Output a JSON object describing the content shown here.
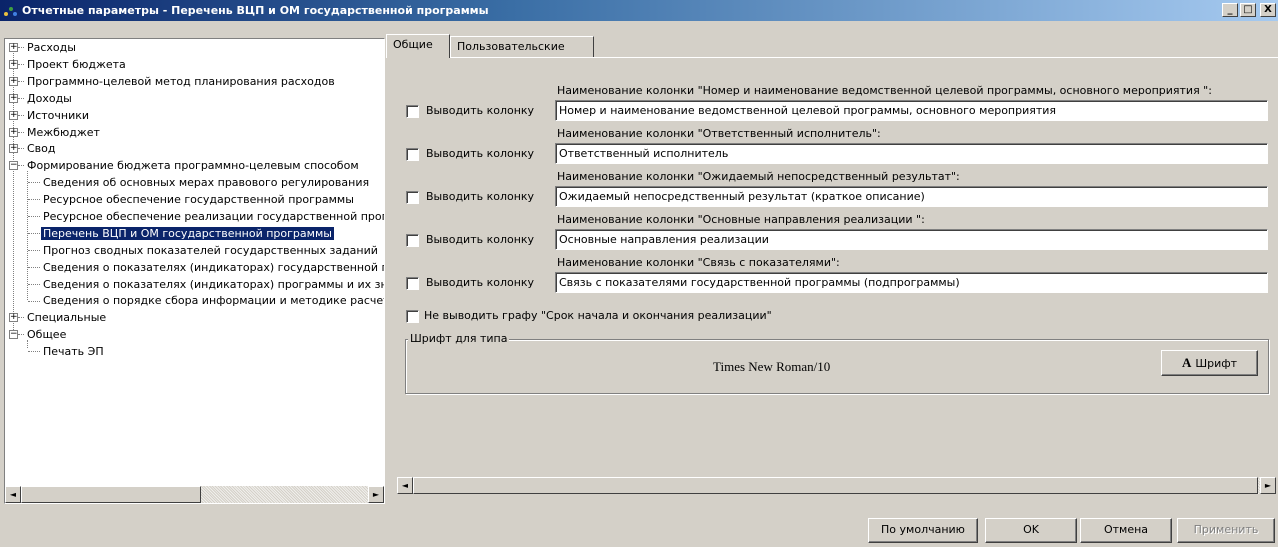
{
  "window": {
    "title": "Отчетные параметры - Перечень ВЦП и ОМ государственной программы",
    "minimize_glyph": "_",
    "maximize_glyph": "□",
    "close_glyph": "X"
  },
  "tree": {
    "items": [
      {
        "label": "Расходы",
        "expander": "+"
      },
      {
        "label": "Проект бюджета",
        "expander": "+"
      },
      {
        "label": "Программно-целевой метод планирования расходов",
        "expander": "+"
      },
      {
        "label": "Доходы",
        "expander": "+"
      },
      {
        "label": "Источники",
        "expander": "+"
      },
      {
        "label": "Межбюджет",
        "expander": "+"
      },
      {
        "label": "Свод",
        "expander": "+"
      },
      {
        "label": "Формирование бюджета программно-целевым способом",
        "expander": "−"
      },
      {
        "label": "Сведения об основных мерах правового регулирования"
      },
      {
        "label": "Ресурсное обеспечение государственной программы"
      },
      {
        "label": "Ресурсное обеспечение реализации государственной программы"
      },
      {
        "label": "Перечень ВЦП и ОМ государственной программы",
        "selected": true
      },
      {
        "label": "Прогноз сводных показателей государственных заданий"
      },
      {
        "label": "Сведения о показателях (индикаторах) государственной программы"
      },
      {
        "label": "Сведения о показателях (индикаторах) программы и их значениях"
      },
      {
        "label": "Сведения о порядке сбора информации и методике расчета"
      },
      {
        "label": "Специальные",
        "expander": "+"
      },
      {
        "label": "Общее",
        "expander": "−"
      },
      {
        "label": "Печать ЭП"
      }
    ]
  },
  "tabs": [
    {
      "label": "Общие",
      "active": true
    },
    {
      "label": "Пользовательские",
      "active": false
    }
  ],
  "columns": [
    {
      "caption": "Наименование колонки \"Номер и наименование ведомственной целевой программы, основного мероприятия \":",
      "checkbox_label": "Выводить колонку",
      "checked": false,
      "value": "Номер и наименование ведомственной целевой программы, основного мероприятия"
    },
    {
      "caption": "Наименование колонки \"Ответственный исполнитель\":",
      "checkbox_label": "Выводить колонку",
      "checked": false,
      "value": "Ответственный исполнитель"
    },
    {
      "caption": "Наименование колонки \"Ожидаемый непосредственный результат\":",
      "checkbox_label": "Выводить колонку",
      "checked": false,
      "value": "Ожидаемый непосредственный результат (краткое описание)"
    },
    {
      "caption": "Наименование колонки \"Основные направления реализации \":",
      "checkbox_label": "Выводить колонку",
      "checked": false,
      "value": "Основные направления реализации"
    },
    {
      "caption": "Наименование колонки \"Связь с показателями\":",
      "checkbox_label": "Выводить колонку",
      "checked": false,
      "value": "Связь с показателями государственной программы (подпрограммы)"
    }
  ],
  "no_period_checkbox": {
    "label": "Не выводить графу \"Срок начала и окончания реализации\"",
    "checked": false
  },
  "font_group": {
    "title": "Шрифт для типа",
    "font_name": "Times New Roman/10",
    "button_icon": "A",
    "button_label": "Шрифт"
  },
  "buttons": {
    "defaults": "По умолчанию",
    "ok": "OK",
    "cancel": "Отмена",
    "apply": "Применить"
  },
  "scroll": {
    "left": "◄",
    "right": "►"
  }
}
